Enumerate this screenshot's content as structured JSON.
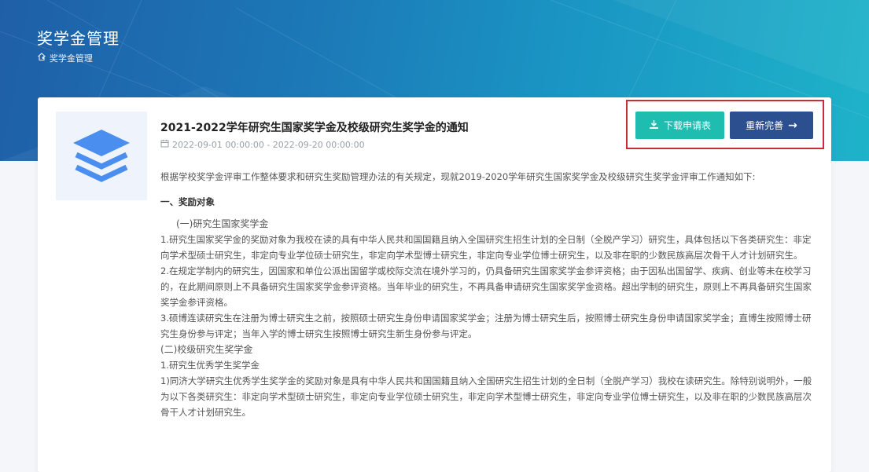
{
  "header": {
    "title": "奖学金管理",
    "breadcrumb_current": "奖学金管理",
    "breadcrumb_separator": "•"
  },
  "notice": {
    "title": "2021-2022学年研究生国家奖学金及校级研究生奖学金的通知",
    "date_range": "2022-09-01 00:00:00 - 2022-09-20 00:00:00"
  },
  "actions": {
    "download_label": "下载申请表",
    "redo_label": "重新完善",
    "redo_arrow": "→"
  },
  "content": {
    "intro": "根据学校奖学金评审工作整体要求和研究生奖励管理办法的有关规定，现就2019-2020学年研究生国家奖学金及校级研究生奖学金评审工作通知如下:",
    "section1_heading": "一、奖励对象",
    "sub1_heading": "(一)研究生国家奖学金",
    "p1": "1.研究生国家奖学金的奖励对象为我校在读的具有中华人民共和国国籍且纳入全国研究生招生计划的全日制（全脱产学习）研究生，具体包括以下各类研究生：非定向学术型硕士研究生，非定向专业学位硕士研究生，非定向学术型博士研究生，非定向专业学位博士研究生，以及非在职的少数民族高层次骨干人才计划研究生。",
    "p2": "2.在规定学制内的研究生，因国家和单位公派出国留学或校际交流在境外学习的，仍具备研究生国家奖学金参评资格；由于因私出国留学、疾病、创业等未在校学习的，在此期间原则上不具备研究生国家奖学金参评资格。当年毕业的研究生，不再具备申请研究生国家奖学金资格。超出学制的研究生，原则上不再具备研究生国家奖学金参评资格。",
    "p3": "3.硕博连读研究生在注册为博士研究生之前，按照硕士研究生身份申请国家奖学金；注册为博士研究生后，按照博士研究生身份申请国家奖学金；直博生按照博士研究生身份参与评定；当年入学的博士研究生按照博士研究生新生身份参与评定。",
    "sub2_heading": "(二)校级研究生奖学金",
    "p4": "1.研究生优秀学生奖学金",
    "p5": "1)同济大学研究生优秀学生奖学金的奖励对象是具有中华人民共和国国籍且纳入全国研究生招生计划的全日制（全脱产学习）我校在读研究生。除特别说明外，一般为以下各类研究生：非定向学术型硕士研究生，非定向专业学位硕士研究生，非定向学术型博士研究生，非定向专业学位博士研究生，以及非在职的少数民族高层次骨干人才计划研究生。"
  },
  "icons": {
    "home": "home-icon",
    "calendar": "calendar-icon",
    "download": "download-icon",
    "arrow": "arrow-right-icon",
    "thumb": "layers-icon"
  },
  "colors": {
    "banner_start": "#1f5fa8",
    "banner_end": "#1eb3c9",
    "download_button": "#1fbcb0",
    "redo_button": "#2c4f8f",
    "highlight_border": "#cc2a35",
    "thumb_icon": "#4a8ef0"
  }
}
